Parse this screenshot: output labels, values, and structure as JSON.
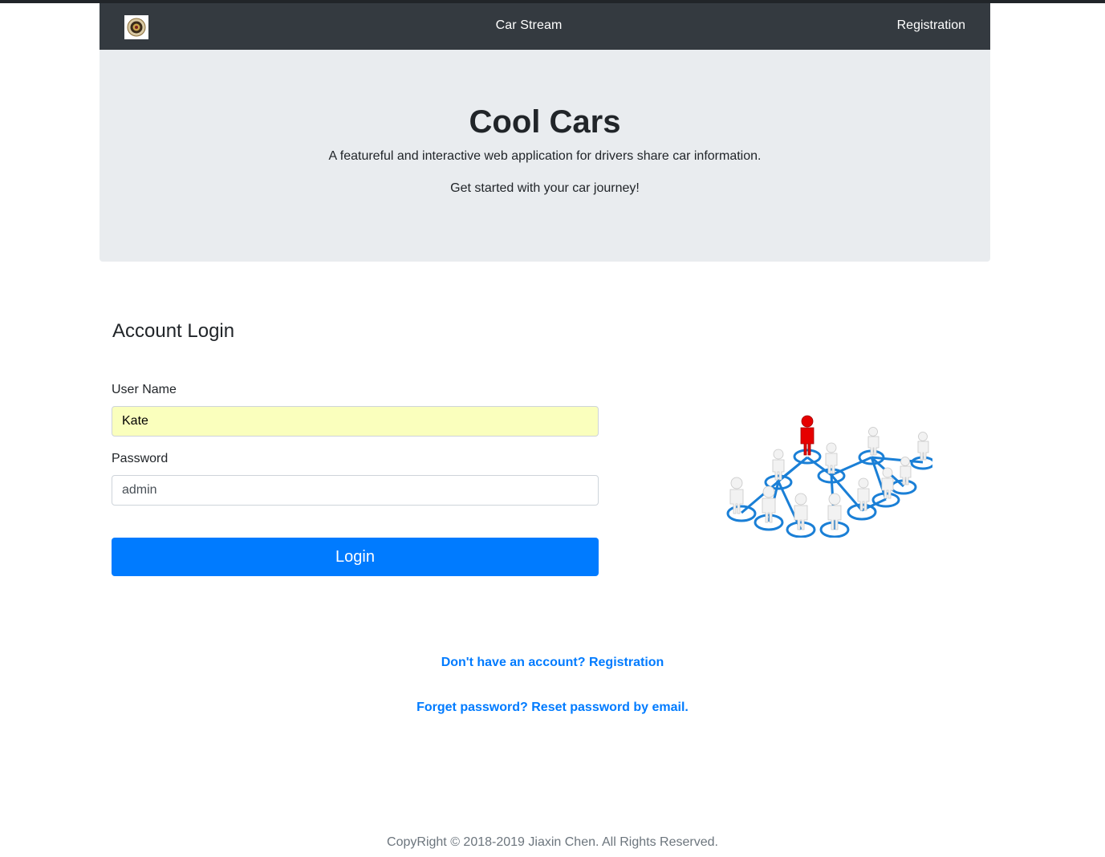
{
  "navbar": {
    "logo_icon": "seal-logo-icon",
    "brand": "Car Stream",
    "registration_link": "Registration",
    "background": "#343a40"
  },
  "jumbotron": {
    "title": "Cool Cars",
    "lead": "A featureful and interactive web application for drivers share car information.",
    "cta": "Get started with your car journey!",
    "background": "#e9ecef"
  },
  "login": {
    "title": "Account Login",
    "username_label": "User Name",
    "username_value": "Kate",
    "password_label": "Password",
    "password_value": "admin",
    "button_label": "Login",
    "button_color": "#007bff"
  },
  "illustration": {
    "icon": "people-network-illustration"
  },
  "links": {
    "register": "Don't have an account? Registration",
    "reset": "Forget password? Reset password by email."
  },
  "footer": {
    "text": "CopyRight © 2018-2019 Jiaxin Chen. All Rights Reserved."
  }
}
